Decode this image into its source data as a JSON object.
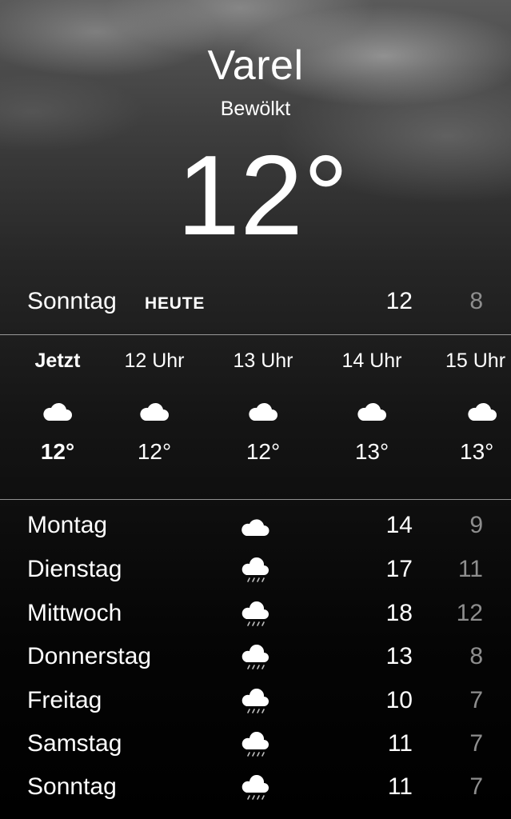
{
  "location": {
    "city": "Varel",
    "condition": "Bewölkt",
    "current_temp": "12°"
  },
  "today": {
    "day": "Sonntag",
    "badge": "HEUTE",
    "high": "12",
    "low": "8"
  },
  "hourly": [
    {
      "label": "Jetzt",
      "icon": "cloud-icon",
      "temp": "12°",
      "is_now": true
    },
    {
      "label": "12 Uhr",
      "icon": "cloud-icon",
      "temp": "12°",
      "is_now": false
    },
    {
      "label": "13 Uhr",
      "icon": "cloud-icon",
      "temp": "12°",
      "is_now": false
    },
    {
      "label": "14 Uhr",
      "icon": "cloud-icon",
      "temp": "13°",
      "is_now": false
    },
    {
      "label": "15 Uhr",
      "icon": "cloud-icon",
      "temp": "13°",
      "is_now": false
    }
  ],
  "daily": [
    {
      "day": "Montag",
      "icon": "cloud-icon",
      "high": "14",
      "low": "9"
    },
    {
      "day": "Dienstag",
      "icon": "cloud-rain-icon",
      "high": "17",
      "low": "11"
    },
    {
      "day": "Mittwoch",
      "icon": "cloud-rain-icon",
      "high": "18",
      "low": "12"
    },
    {
      "day": "Donnerstag",
      "icon": "cloud-rain-icon",
      "high": "13",
      "low": "8"
    },
    {
      "day": "Freitag",
      "icon": "cloud-rain-icon",
      "high": "10",
      "low": "7"
    },
    {
      "day": "Samstag",
      "icon": "cloud-rain-icon",
      "high": "11",
      "low": "7"
    },
    {
      "day": "Sonntag",
      "icon": "cloud-rain-icon",
      "high": "11",
      "low": "7"
    }
  ],
  "colors": {
    "text_primary": "#ffffff",
    "text_secondary": "#8e8e8e",
    "divider": "#8c8c8c"
  }
}
